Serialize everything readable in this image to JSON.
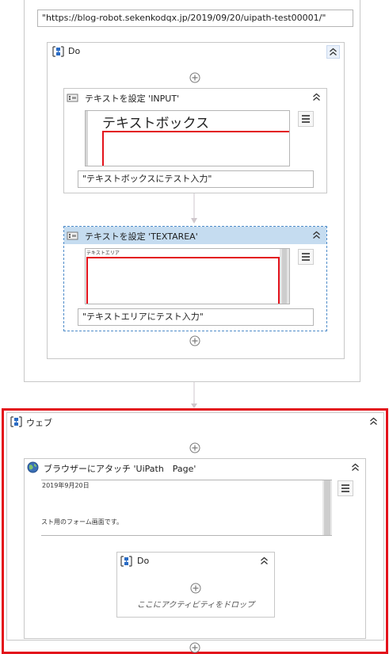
{
  "top": {
    "url_value": "\"https://blog-robot.sekenkodqx.jp/2019/09/20/uipath-test00001/\""
  },
  "do_outer": {
    "title": "Do"
  },
  "set_text_input": {
    "title": "テキストを設定 'INPUT'",
    "preview_text": "テキストボックス",
    "value": "\"テキストボックスにテスト入力\""
  },
  "set_text_textarea": {
    "title": "テキストを設定 'TEXTAREA'",
    "preview_label": "テキストエリア",
    "value": "\"テキストエリアにテスト入力\""
  },
  "web": {
    "title": "ウェブ"
  },
  "attach_browser": {
    "title": "ブラウザーにアタッチ 'UiPath　Page'",
    "preview_date": "2019年9月20日",
    "preview_text": "スト用のフォーム画面です。"
  },
  "do_inner": {
    "title": "Do",
    "drop_hint": "ここにアクティビティをドロップ"
  },
  "colors": {
    "accent_red": "#e3121b",
    "selected_header": "#c5dcf0",
    "selected_border": "#4f8cc9"
  }
}
